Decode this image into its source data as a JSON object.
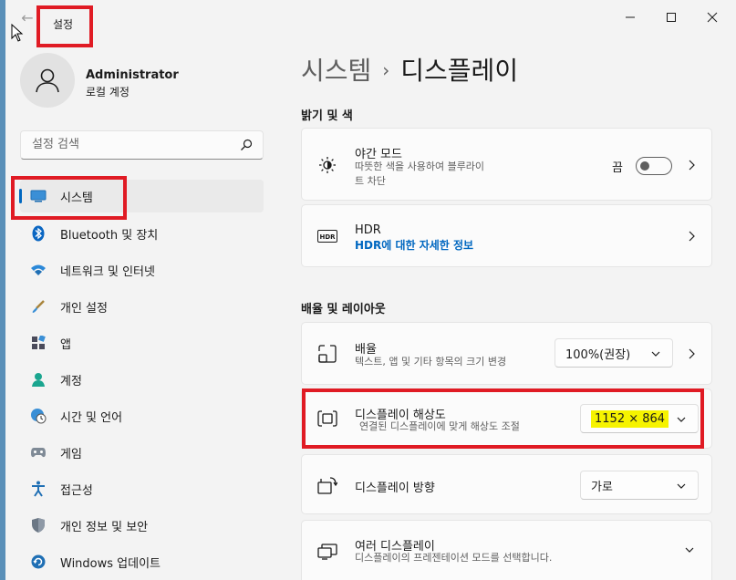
{
  "window": {
    "title": "설정"
  },
  "user": {
    "name": "Administrator",
    "account_type": "로컬 계정"
  },
  "search": {
    "placeholder": "설정 검색"
  },
  "sidebar": {
    "items": [
      {
        "label": "시스템",
        "icon": "system-icon",
        "active": true
      },
      {
        "label": "Bluetooth 및 장치",
        "icon": "bluetooth-icon"
      },
      {
        "label": "네트워크 및 인터넷",
        "icon": "wifi-icon"
      },
      {
        "label": "개인 설정",
        "icon": "brush-icon"
      },
      {
        "label": "앱",
        "icon": "apps-icon"
      },
      {
        "label": "계정",
        "icon": "account-icon"
      },
      {
        "label": "시간 및 언어",
        "icon": "globe-clock-icon"
      },
      {
        "label": "게임",
        "icon": "gamepad-icon"
      },
      {
        "label": "접근성",
        "icon": "accessibility-icon"
      },
      {
        "label": "개인 정보 및 보안",
        "icon": "shield-icon"
      },
      {
        "label": "Windows 업데이트",
        "icon": "update-icon"
      }
    ]
  },
  "breadcrumb": {
    "parent": "시스템",
    "separator": "›",
    "current": "디스플레이"
  },
  "sections": {
    "brightness_color": "밝기 및 색",
    "scale_layout": "배율 및 레이아웃"
  },
  "settings": {
    "night_light": {
      "title": "야간 모드",
      "desc_line1": "따뜻한 색을 사용하여 블루라이",
      "desc_line2": "트 차단",
      "state_label": "끔",
      "state": "off"
    },
    "hdr": {
      "title": "HDR",
      "link": "HDR에 대한 자세한 정보"
    },
    "scale": {
      "title": "배율",
      "desc": "텍스트, 앱 및 기타 항목의 크기 변경",
      "value": "100%(권장)"
    },
    "resolution": {
      "title": "디스플레이 해상도",
      "desc": "연결된 디스플레이에 맞게 해상도 조절",
      "value": "1152 × 864"
    },
    "orientation": {
      "title": "디스플레이 방향",
      "value": "가로"
    },
    "multiple_displays": {
      "title": "여러 디스플레이",
      "desc": "디스플레이의 프레젠테이션 모드를 선택합니다."
    }
  },
  "colors": {
    "accent": "#0067c0",
    "highlight": "#f6f300",
    "annotation_red": "#e01b24"
  }
}
